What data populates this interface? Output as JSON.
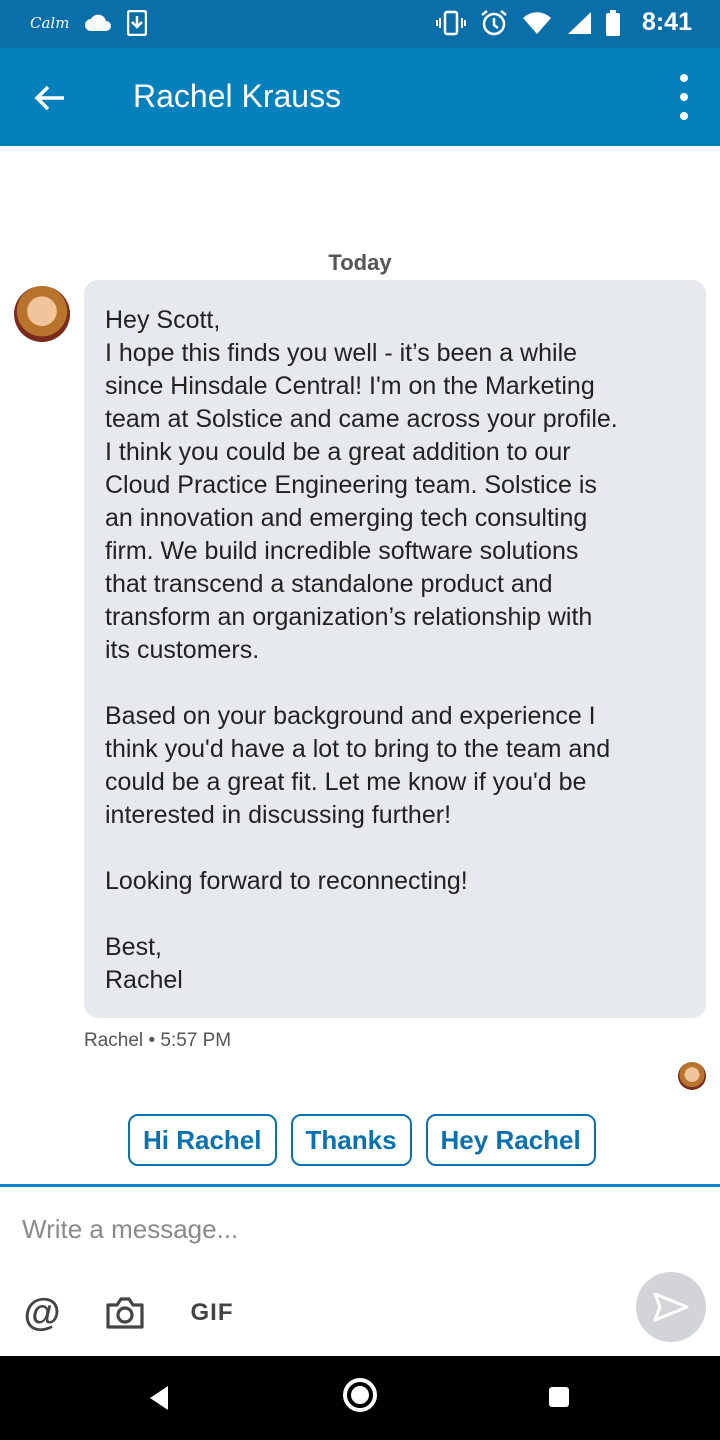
{
  "status_bar": {
    "app_label": "Calm",
    "time": "8:41",
    "icons": [
      "cloud-icon",
      "download-icon",
      "vibrate-icon",
      "alarm-icon",
      "wifi-icon",
      "signal-icon",
      "battery-icon"
    ]
  },
  "header": {
    "title": "Rachel Krauss",
    "back_icon": "arrow-left-icon",
    "menu_icon": "more-vert-icon"
  },
  "conversation": {
    "date_divider": "Today",
    "message": {
      "paragraphs": [
        [
          "Hey Scott,",
          "I hope this finds you well - it’s been a while",
          "since Hinsdale Central! I'm on the Marketing",
          "team at Solstice and came across your profile.",
          "I think you could be a great addition to our",
          "Cloud Practice Engineering team. Solstice is",
          "an innovation and emerging tech consulting",
          "firm. We build incredible software solutions",
          "that transcend a standalone product and",
          "transform an organization’s relationship with",
          "its customers."
        ],
        [
          "Based on your background and experience I",
          "think you'd have a lot to bring to the team and",
          "could be a great fit. Let me know if you'd be",
          "interested in discussing further!"
        ],
        [
          "Looking forward to reconnecting!"
        ],
        [
          "Best,",
          "Rachel"
        ]
      ],
      "sender": "Rachel",
      "time": "5:57 PM",
      "separator": "•"
    }
  },
  "quick_replies": [
    "Hi Rachel",
    "Thanks",
    "Hey Rachel"
  ],
  "composer": {
    "placeholder": "Write a message...",
    "tools": {
      "mention": "@",
      "camera_icon": "camera-icon",
      "gif": "GIF"
    },
    "send_icon": "send-icon"
  },
  "colors": {
    "status_bar": "#0a6fa8",
    "app_bar": "#0480bd",
    "accent": "#0a72b0",
    "bubble": "#e6e9ed"
  }
}
